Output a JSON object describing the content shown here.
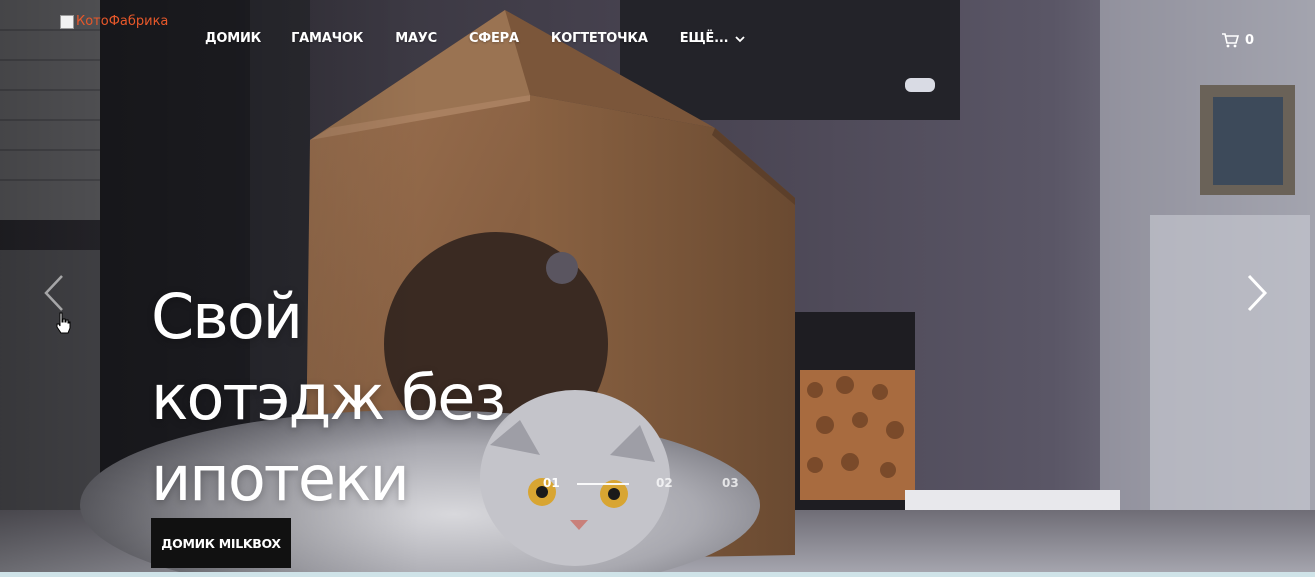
{
  "header": {
    "logo_alt": "КотоФабрика",
    "nav": [
      "ДОМИК",
      "ГАМАЧОК",
      "МАУС",
      "СФЕРА",
      "КОГТЕТОЧКА",
      "ЕЩЁ..."
    ],
    "cart_count": "0"
  },
  "slider": {
    "headline_lines": [
      "Свой",
      "котэдж без",
      "ипотеки"
    ],
    "cta_label": "ДОМИК MILKBOX",
    "pages": [
      "01",
      "02",
      "03"
    ],
    "active_page": "01"
  },
  "icons": {
    "prev": "chevron-left-icon",
    "next": "chevron-right-icon",
    "cart": "cart-icon",
    "dropdown": "chevron-down-icon"
  }
}
